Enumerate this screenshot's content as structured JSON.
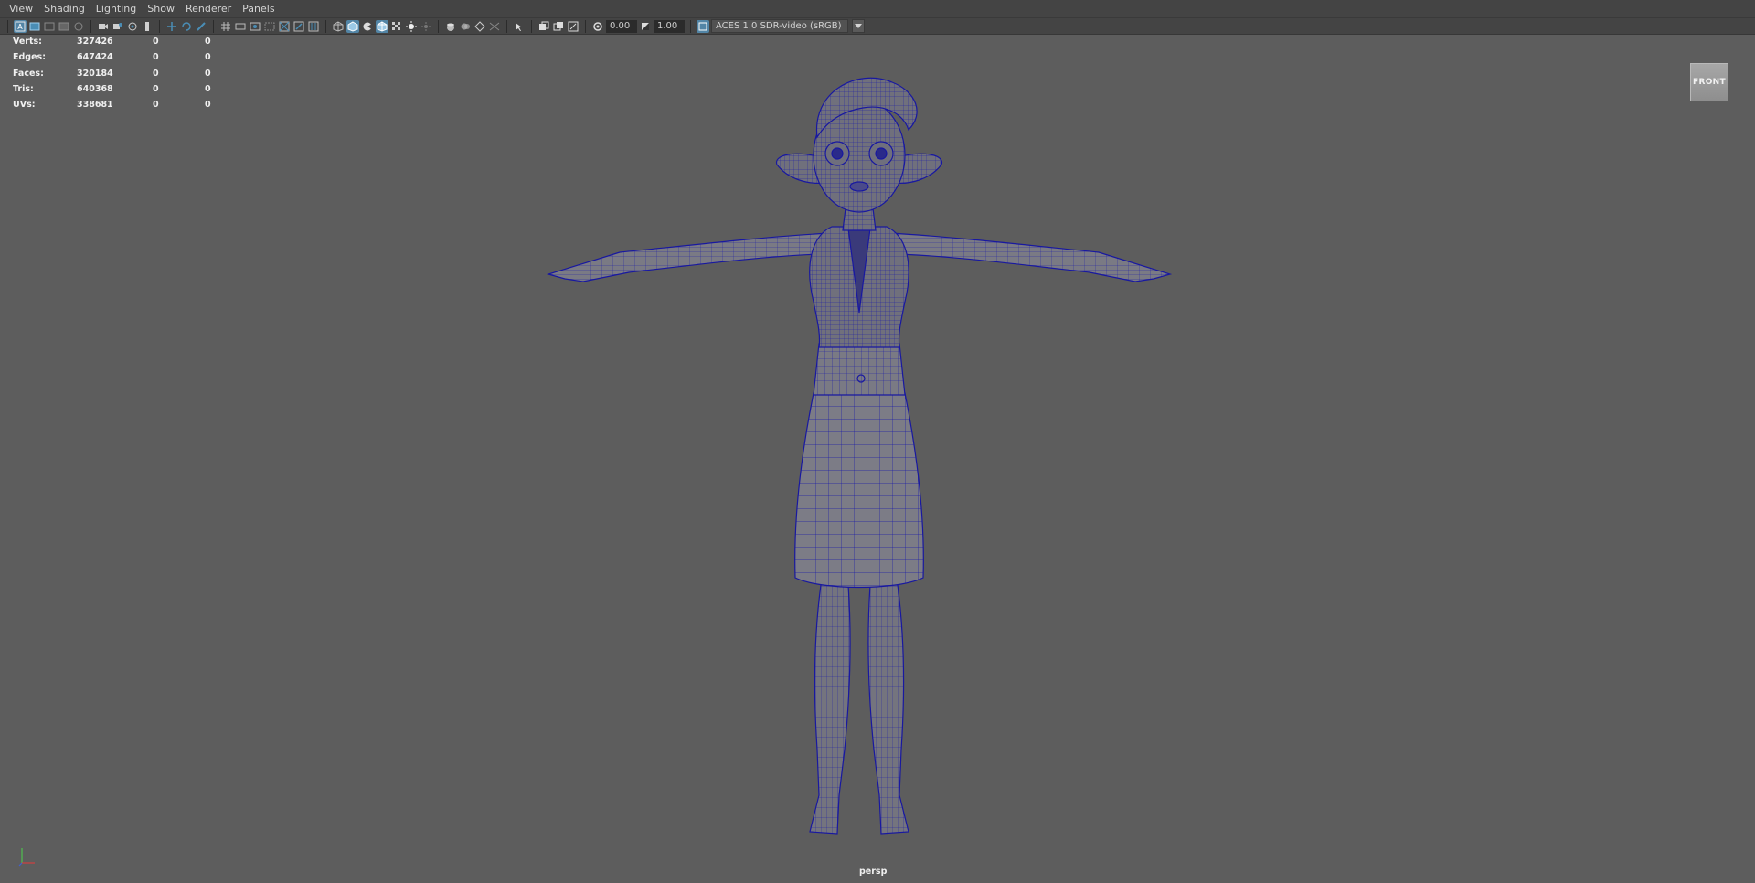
{
  "menubar": {
    "items": [
      "View",
      "Shading",
      "Lighting",
      "Show",
      "Renderer",
      "Panels"
    ]
  },
  "toolbar": {
    "exposure_value": "0.00",
    "gamma_value": "1.00",
    "color_space": "ACES 1.0 SDR-video (sRGB)",
    "active_color": "#5285a6",
    "icons": [
      "select-camera-icon",
      "camera-attributes-icon",
      "bookmarks-icon",
      "image-plane-icon",
      "2d-pan-zoom-icon",
      "grease-pencil-icon",
      "camera-icon",
      "lock-camera-icon",
      "camera-bookmark-icon",
      "grid-icon",
      "film-gate-icon",
      "resolution-gate-icon",
      "gate-mask-icon",
      "field-chart-icon",
      "safe-action-icon",
      "safe-title-icon",
      "wireframe-icon",
      "smooth-shade-icon",
      "default-material-icon",
      "wireframe-on-shaded-icon",
      "textured-icon",
      "use-all-lights-icon",
      "shadows-icon",
      "screen-space-ao-icon",
      "motion-blur-icon",
      "multisample-aa-icon",
      "depth-of-field-icon",
      "isolate-select-icon",
      "xray-icon",
      "xray-joints-icon",
      "xray-components-icon",
      "exposure-icon",
      "gamma-icon",
      "view-transform-icon"
    ]
  },
  "hud": {
    "rows": [
      {
        "label": "Verts:",
        "v1": "327426",
        "v2": "0",
        "v3": "0"
      },
      {
        "label": "Edges:",
        "v1": "647424",
        "v2": "0",
        "v3": "0"
      },
      {
        "label": "Faces:",
        "v1": "320184",
        "v2": "0",
        "v3": "0"
      },
      {
        "label": "Tris:",
        "v1": "640368",
        "v2": "0",
        "v3": "0"
      },
      {
        "label": "UVs:",
        "v1": "338681",
        "v2": "0",
        "v3": "0"
      }
    ]
  },
  "viewcube": {
    "label": "FRONT"
  },
  "camera": {
    "label": "persp"
  },
  "viewport": {
    "background": "#5d5d5d",
    "wire_color": "#1a1aa8",
    "shade_color": "#787880"
  }
}
